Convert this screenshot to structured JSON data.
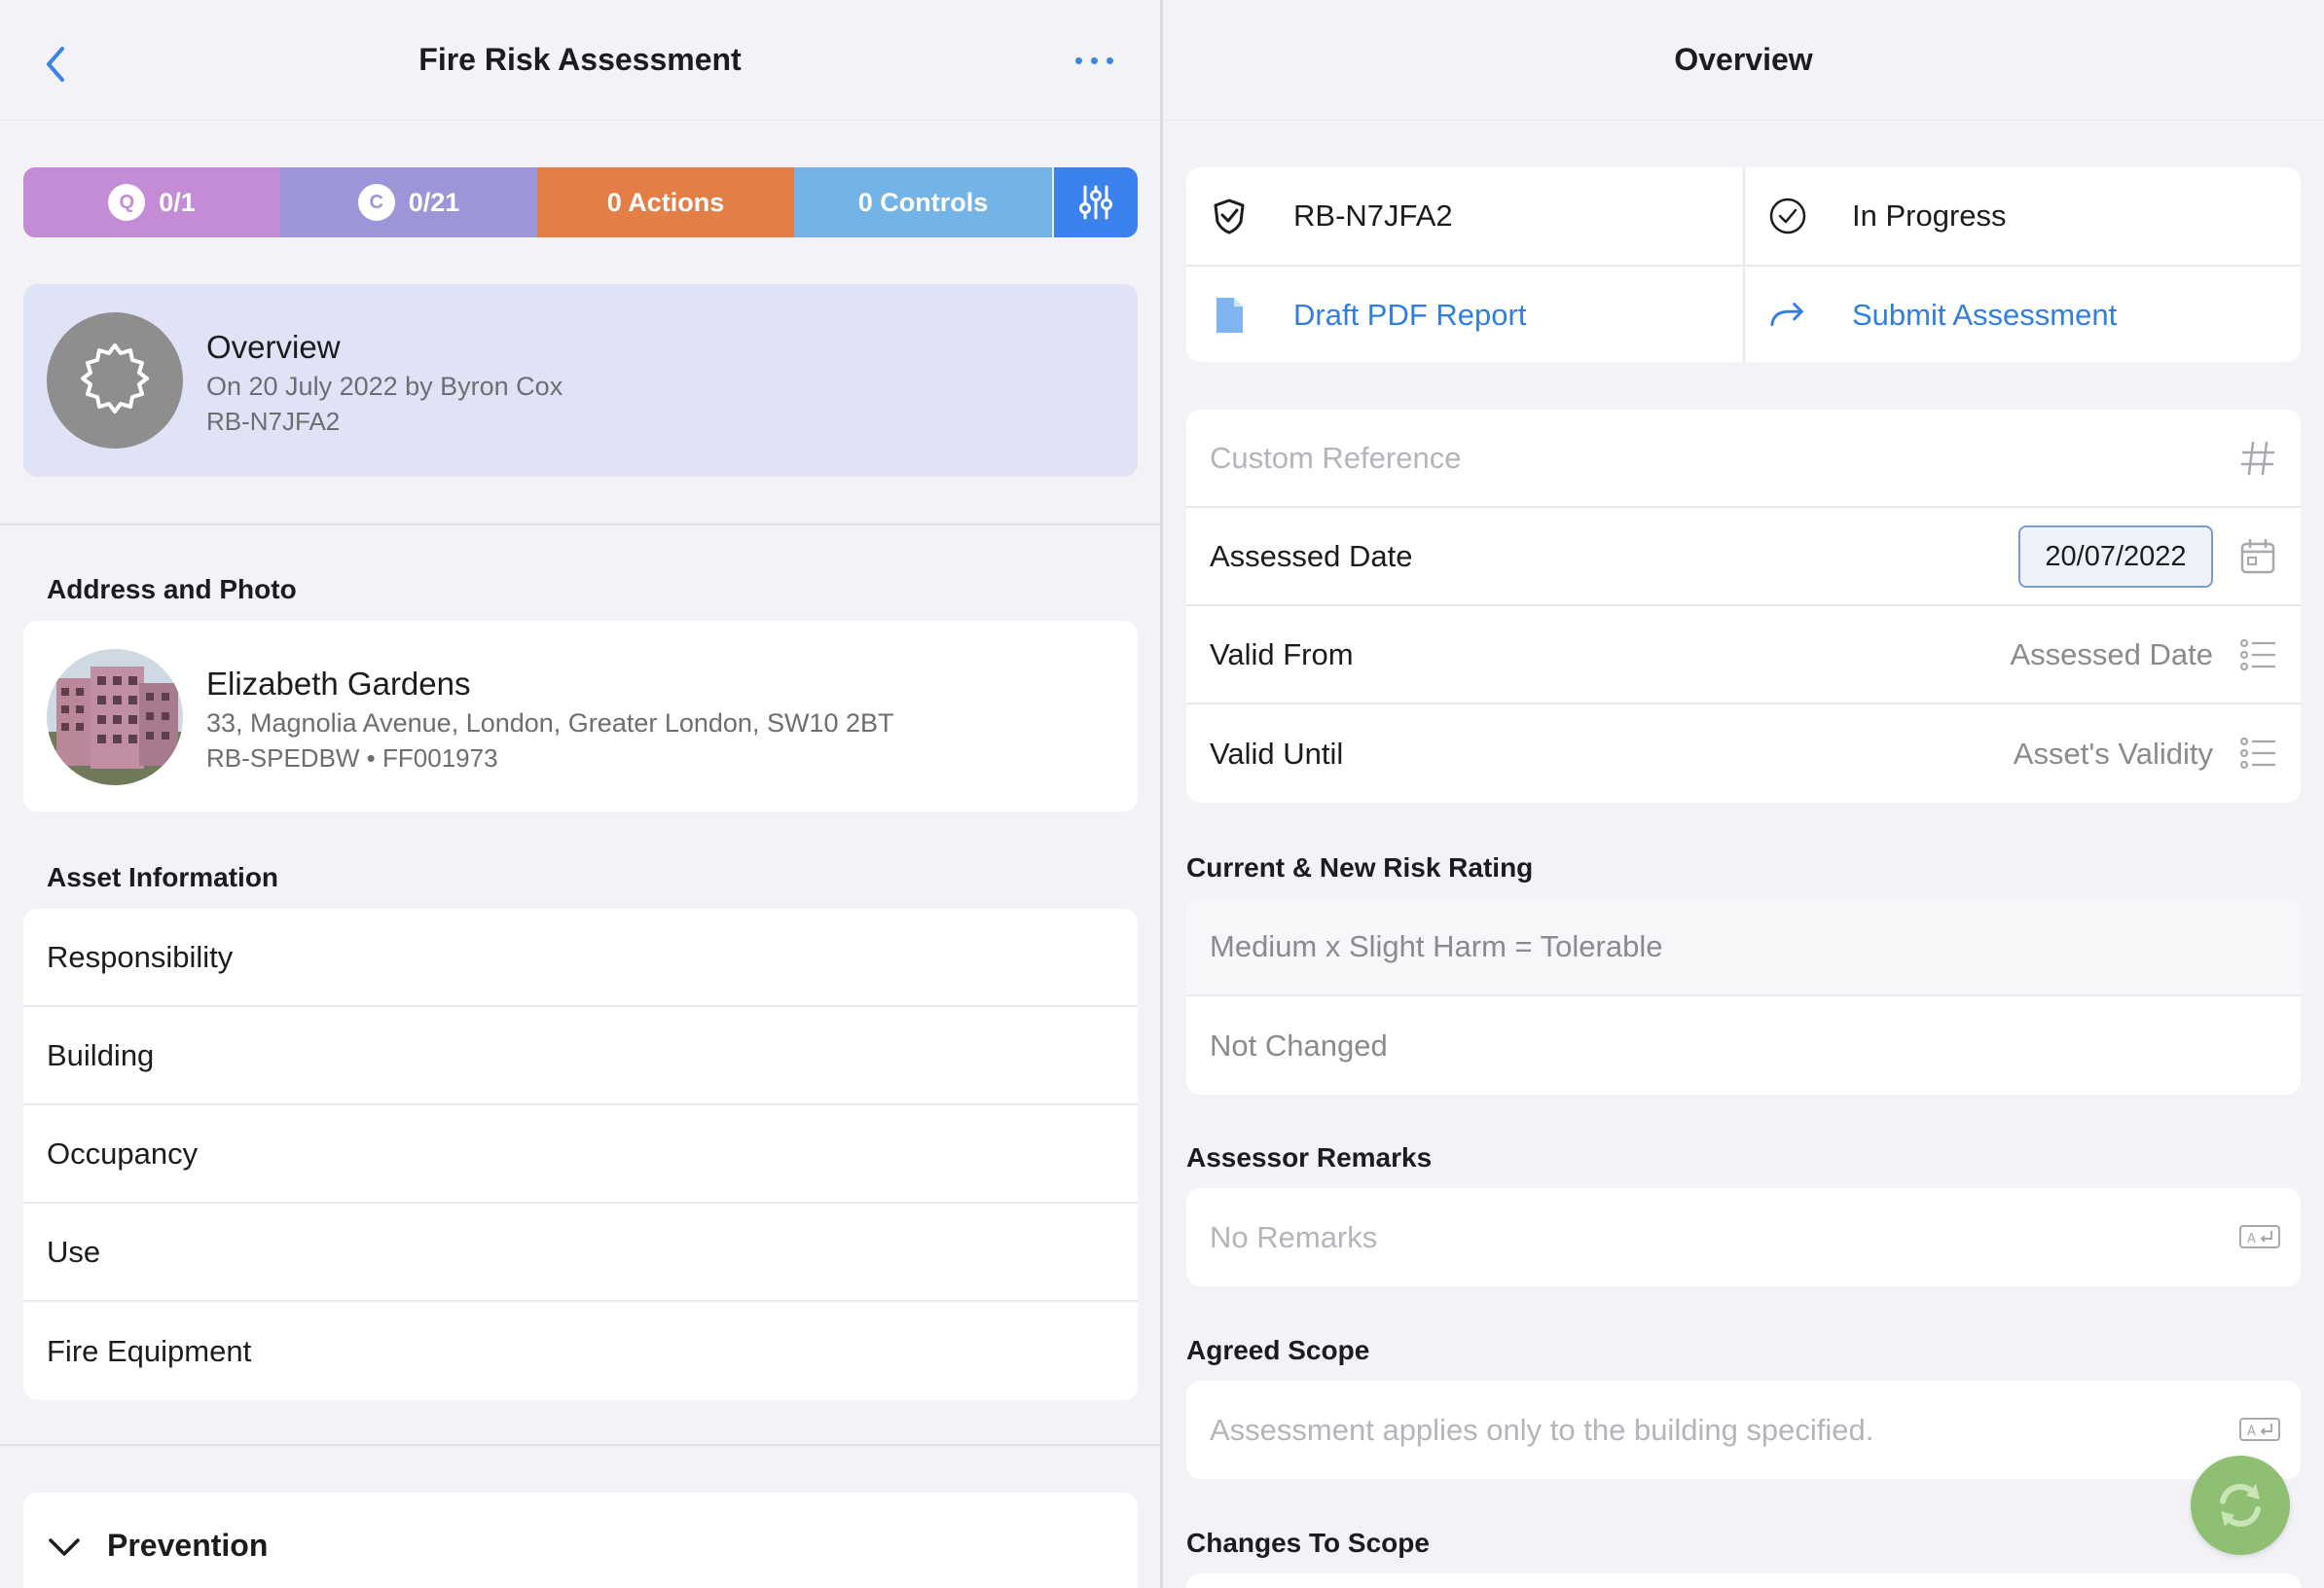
{
  "left": {
    "nav": {
      "title": "Fire Risk Assessment"
    },
    "status_bar": {
      "questions": {
        "badge": "Q",
        "label": "0/1"
      },
      "controls_count": {
        "badge": "C",
        "label": "0/21"
      },
      "actions": {
        "label": "0 Actions"
      },
      "controls": {
        "label": "0 Controls"
      }
    },
    "overview": {
      "title": "Overview",
      "subtitle": "On 20 July 2022 by Byron Cox",
      "ref": "RB-N7JFA2"
    },
    "address_section_label": "Address and Photo",
    "address": {
      "title": "Elizabeth Gardens",
      "line": "33, Magnolia Avenue, London, Greater London, SW10 2BT",
      "ref": "RB-SPEDBW • FF001973"
    },
    "asset_section_label": "Asset Information",
    "asset_items": [
      "Responsibility",
      "Building",
      "Occupancy",
      "Use",
      "Fire Equipment"
    ],
    "prevention": {
      "label": "Prevention"
    }
  },
  "right": {
    "nav": {
      "title": "Overview"
    },
    "info": {
      "ref": "RB-N7JFA2",
      "status": "In Progress",
      "draft": "Draft PDF Report",
      "submit": "Submit Assessment"
    },
    "form": {
      "custom_reference_placeholder": "Custom Reference",
      "assessed_date_label": "Assessed Date",
      "assessed_date_value": "20/07/2022",
      "valid_from_label": "Valid From",
      "valid_from_value": "Assessed Date",
      "valid_until_label": "Valid Until",
      "valid_until_value": "Asset's Validity"
    },
    "risk_section_label": "Current & New Risk Rating",
    "risk_current": "Medium x Slight Harm = Tolerable",
    "risk_new": "Not Changed",
    "remarks_section_label": "Assessor Remarks",
    "remarks_placeholder": "No Remarks",
    "scope_section_label": "Agreed Scope",
    "scope_placeholder": "Assessment applies only to the building specified.",
    "changes_section_label": "Changes To Scope"
  },
  "colors": {
    "accent": "#3b82ef",
    "questions": "#c48cd7",
    "controls_count": "#9c95d8",
    "actions": "#e27e46",
    "controls": "#74b3e5",
    "sync_button": "#8fbf72"
  },
  "icons": {
    "back": "chevron-left-icon",
    "more": "ellipsis-icon",
    "filter": "sliders-icon",
    "overview": "gear-icon",
    "prevention": "chevron-down-icon",
    "ref": "shield-check-icon",
    "status": "check-circle-icon",
    "draft": "document-icon",
    "submit": "share-arrow-icon",
    "hash": "hash-icon",
    "calendar": "calendar-icon",
    "list": "list-icon",
    "keyboard": "keyboard-return-icon",
    "sync": "sync-icon"
  }
}
